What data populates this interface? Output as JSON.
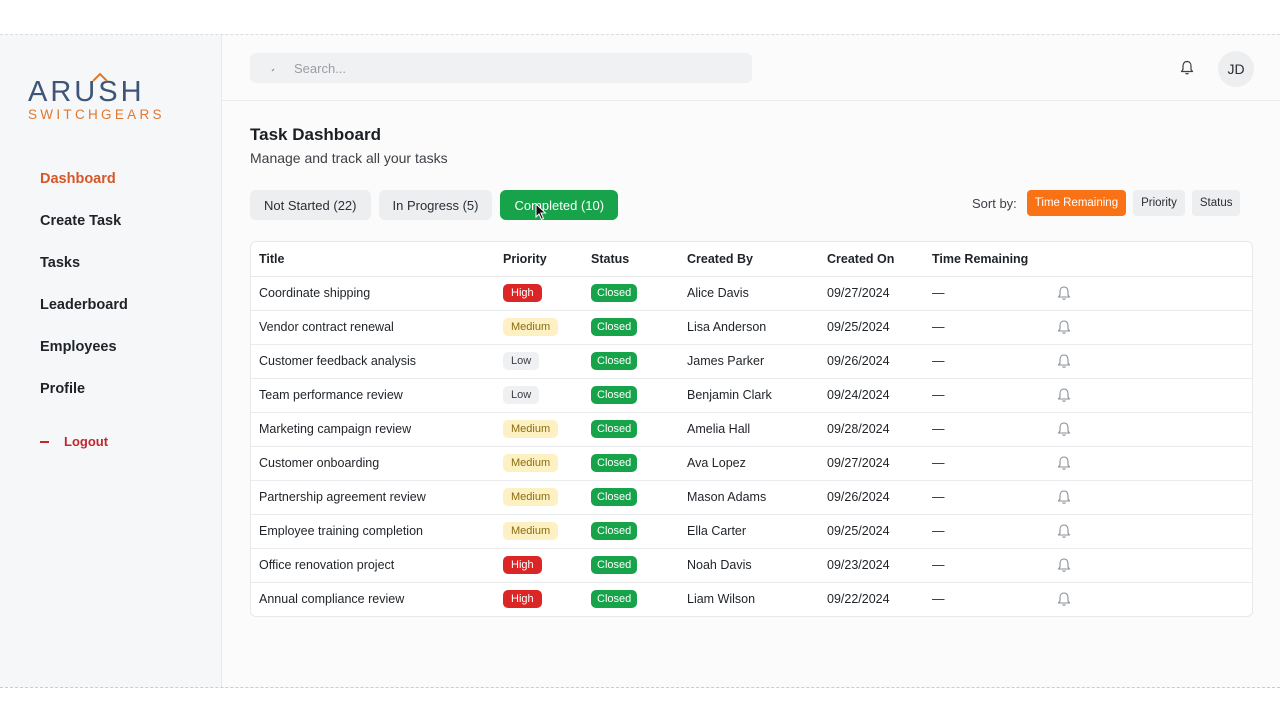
{
  "logo": {
    "brand": "ARUSH",
    "sub": "SWITCHGEARS"
  },
  "sidebar": {
    "items": [
      {
        "label": "Dashboard",
        "active": true
      },
      {
        "label": "Create Task",
        "active": false
      },
      {
        "label": "Tasks",
        "active": false
      },
      {
        "label": "Leaderboard",
        "active": false
      },
      {
        "label": "Employees",
        "active": false
      },
      {
        "label": "Profile",
        "active": false
      }
    ],
    "logout_label": "Logout"
  },
  "topbar": {
    "search_placeholder": "Search...",
    "notification_icon": "bell-icon",
    "avatar_initials": "JD"
  },
  "header": {
    "title": "Task Dashboard",
    "subtitle": "Manage and track all your tasks"
  },
  "tabs": [
    {
      "label": "Not Started (22)",
      "active": false
    },
    {
      "label": "In Progress (5)",
      "active": false
    },
    {
      "label": "Completed (10)",
      "active": true
    }
  ],
  "sort": {
    "label": "Sort by:",
    "options": [
      {
        "label": "Time Remaining",
        "active": true
      },
      {
        "label": "Priority",
        "active": false
      },
      {
        "label": "Status",
        "active": false
      }
    ]
  },
  "table": {
    "columns": [
      "Title",
      "Priority",
      "Status",
      "Created By",
      "Created On",
      "Time Remaining"
    ],
    "rows": [
      {
        "title": "Coordinate shipping",
        "priority": "High",
        "status": "Closed",
        "created_by": "Alice Davis",
        "created_on": "09/27/2024",
        "time_remaining": "—"
      },
      {
        "title": "Vendor contract renewal",
        "priority": "Medium",
        "status": "Closed",
        "created_by": "Lisa Anderson",
        "created_on": "09/25/2024",
        "time_remaining": "—"
      },
      {
        "title": "Customer feedback analysis",
        "priority": "Low",
        "status": "Closed",
        "created_by": "James Parker",
        "created_on": "09/26/2024",
        "time_remaining": "—"
      },
      {
        "title": "Team performance review",
        "priority": "Low",
        "status": "Closed",
        "created_by": "Benjamin Clark",
        "created_on": "09/24/2024",
        "time_remaining": "—"
      },
      {
        "title": "Marketing campaign review",
        "priority": "Medium",
        "status": "Closed",
        "created_by": "Amelia Hall",
        "created_on": "09/28/2024",
        "time_remaining": "—"
      },
      {
        "title": "Customer onboarding",
        "priority": "Medium",
        "status": "Closed",
        "created_by": "Ava Lopez",
        "created_on": "09/27/2024",
        "time_remaining": "—"
      },
      {
        "title": "Partnership agreement review",
        "priority": "Medium",
        "status": "Closed",
        "created_by": "Mason Adams",
        "created_on": "09/26/2024",
        "time_remaining": "—"
      },
      {
        "title": "Employee training completion",
        "priority": "Medium",
        "status": "Closed",
        "created_by": "Ella Carter",
        "created_on": "09/25/2024",
        "time_remaining": "—"
      },
      {
        "title": "Office renovation project",
        "priority": "High",
        "status": "Closed",
        "created_by": "Noah Davis",
        "created_on": "09/23/2024",
        "time_remaining": "—"
      },
      {
        "title": "Annual compliance review",
        "priority": "High",
        "status": "Closed",
        "created_by": "Liam Wilson",
        "created_on": "09/22/2024",
        "time_remaining": "—"
      }
    ]
  },
  "colors": {
    "accent": "#d4582a",
    "completed_tab": "#16a34a",
    "sort_active": "#f97316",
    "priority_high": "#dc2626",
    "priority_medium": "#fdf0c2",
    "priority_low": "#eef0f2",
    "status_closed": "#16a34a",
    "logout": "#c0282d"
  }
}
